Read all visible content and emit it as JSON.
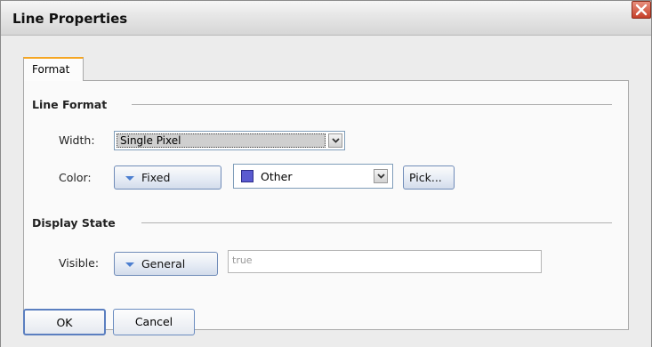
{
  "dialog": {
    "title": "Line Properties",
    "close_icon": "close-icon"
  },
  "tabs": [
    {
      "label": "Format",
      "selected": true
    }
  ],
  "line_format": {
    "group_title": "Line Format",
    "width": {
      "label": "Width:",
      "value": "Single Pixel",
      "dropdown_icon": "chevron-down-icon"
    },
    "color": {
      "label": "Color:",
      "mode_label": "Fixed",
      "mode_icon": "triangle-down-icon",
      "value": "Other",
      "swatch_color": "#5a5ad0",
      "pick_label": "Pick..."
    }
  },
  "display_state": {
    "group_title": "Display State",
    "visible": {
      "label": "Visible:",
      "mode_label": "General",
      "mode_icon": "triangle-down-icon",
      "value": "true"
    }
  },
  "footer": {
    "ok_label": "OK",
    "cancel_label": "Cancel"
  },
  "colors": {
    "tab_accent": "#f5a623",
    "close_button": "#c6402a",
    "button_border": "#6f8bb8"
  }
}
